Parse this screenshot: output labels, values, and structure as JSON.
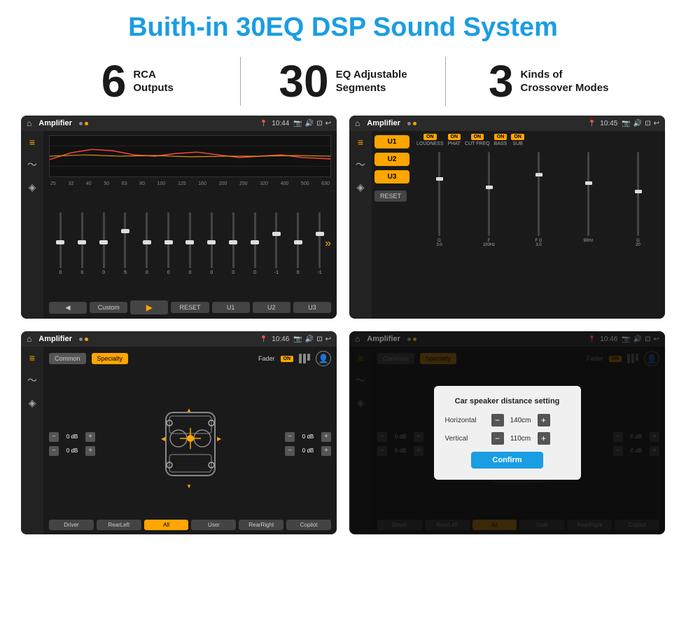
{
  "header": {
    "title": "Buith-in 30EQ DSP Sound System"
  },
  "stats": [
    {
      "number": "6",
      "label": "RCA\nOutputs"
    },
    {
      "number": "30",
      "label": "EQ Adjustable\nSegments"
    },
    {
      "number": "3",
      "label": "Kinds of\nCrossover Modes"
    }
  ],
  "screens": [
    {
      "id": "screen1",
      "statusTime": "10:44",
      "title": "Amplifier",
      "type": "eq"
    },
    {
      "id": "screen2",
      "statusTime": "10:45",
      "title": "Amplifier",
      "type": "amp"
    },
    {
      "id": "screen3",
      "statusTime": "10:46",
      "title": "Amplifier",
      "type": "crossover"
    },
    {
      "id": "screen4",
      "statusTime": "10:46",
      "title": "Amplifier",
      "type": "dialog"
    }
  ],
  "eq": {
    "freqs": [
      "25",
      "32",
      "40",
      "50",
      "63",
      "80",
      "100",
      "125",
      "160",
      "200",
      "250",
      "320",
      "400",
      "500",
      "630"
    ],
    "values": [
      "0",
      "0",
      "0",
      "5",
      "0",
      "0",
      "0",
      "0",
      "0",
      "0",
      "-1",
      "0",
      "-1"
    ],
    "presets": [
      "Custom",
      "RESET",
      "U1",
      "U2",
      "U3"
    ]
  },
  "amp": {
    "users": [
      "U1",
      "U2",
      "U3"
    ],
    "toggles": [
      "LOUDNESS",
      "PHAT",
      "CUT FREQ",
      "BASS",
      "SUB"
    ],
    "resetLabel": "RESET"
  },
  "crossover": {
    "tabs": [
      "Common",
      "Specialty"
    ],
    "faderLabel": "Fader",
    "faderOnLabel": "ON",
    "buttons": [
      "Driver",
      "RearLeft",
      "All",
      "User",
      "RearRight",
      "Copilot"
    ],
    "dbValues": [
      "0 dB",
      "0 dB",
      "0 dB",
      "0 dB"
    ]
  },
  "dialog": {
    "title": "Car speaker distance setting",
    "horizontalLabel": "Horizontal",
    "horizontalValue": "140cm",
    "verticalLabel": "Vertical",
    "verticalValue": "110cm",
    "confirmLabel": "Confirm"
  },
  "colors": {
    "accent": "#1a9de3",
    "orange": "#ffa500",
    "darkBg": "#1a1a1a",
    "text": "#ffffff"
  }
}
